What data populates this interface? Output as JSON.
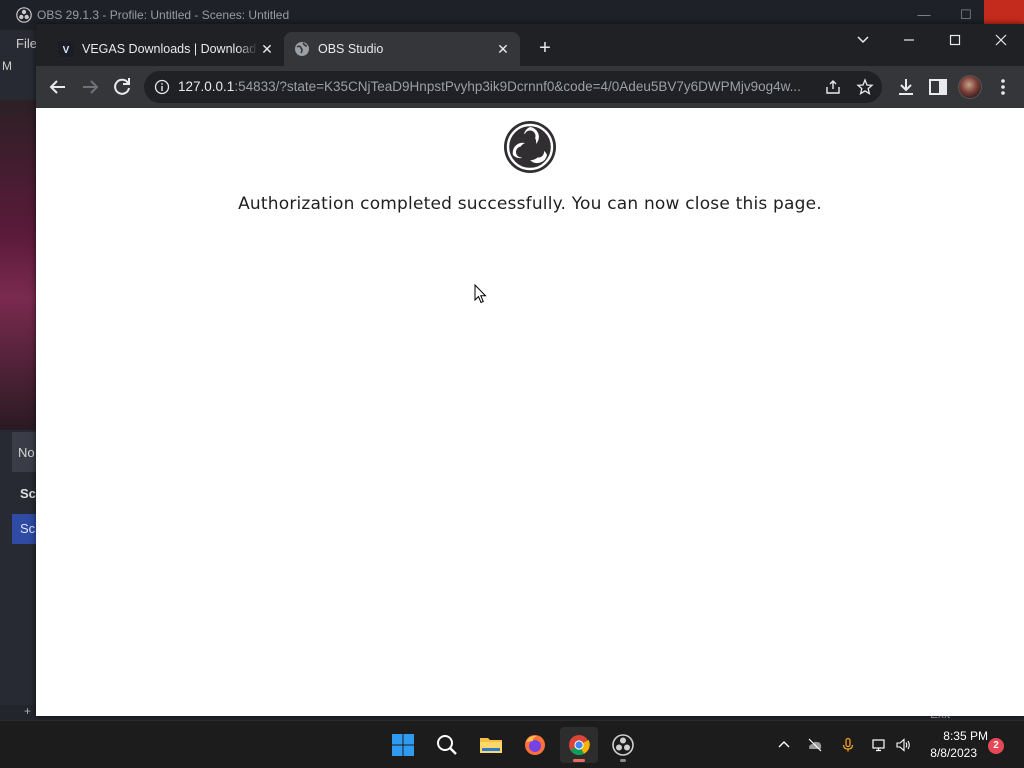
{
  "obs": {
    "title": "OBS 29.1.3 - Profile: Untitled - Scenes: Untitled",
    "menu_file": "File",
    "menu_m": "M",
    "dock_no": "No",
    "dock_sc_header": "Sc",
    "dock_sc_selected": "Sc",
    "exit_label": "Exit"
  },
  "browser": {
    "tabs": [
      {
        "label": "VEGAS Downloads | Download in",
        "favicon": "vegas-v-icon",
        "favicon_letter": "V",
        "active": false
      },
      {
        "label": "OBS Studio",
        "favicon": "globe-icon",
        "active": true
      }
    ],
    "url_host": "127.0.0.1",
    "url_rest": ":54833/?state=K35CNjTeaD9HnpstPvyhp3ik9Dcrnnf0&code=4/0Adeu5BV7y6DWPMjv9og4w..."
  },
  "page": {
    "message": "Authorization completed successfully. You can now close this page."
  },
  "taskbar": {
    "apps": [
      "start-icon",
      "search-icon",
      "file-explorer-icon",
      "firefox-icon",
      "chrome-icon",
      "obs-icon"
    ],
    "time": "8:35 PM",
    "date": "8/8/2023",
    "notification_count": "2"
  },
  "colors": {
    "chrome_frame": "#202124",
    "chrome_toolbar": "#35363a",
    "obs_bg": "#272a33",
    "taskbar": "#1c1c1c",
    "close_red": "#c42b1c"
  }
}
